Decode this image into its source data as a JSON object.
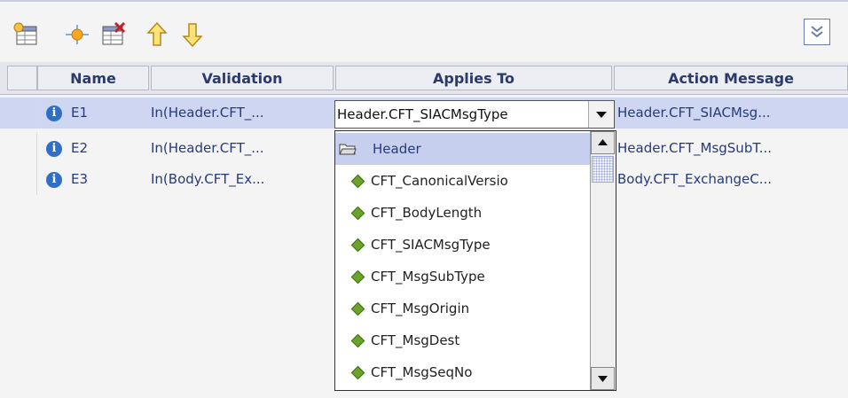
{
  "toolbar": {
    "icons": [
      "add-row-icon",
      "add-child-icon",
      "delete-row-icon",
      "move-up-icon",
      "move-down-icon",
      "collapse-icon"
    ]
  },
  "grid": {
    "columns": [
      "Name",
      "Validation",
      "Applies To",
      "Action Message"
    ],
    "rows": [
      {
        "name": "E1",
        "validation": "In(Header.CFT_...",
        "applies_to": "eader.CFT_SIACMsgType",
        "action_message": "Header.CFT_SIACMsg..."
      },
      {
        "name": "E2",
        "validation": "In(Header.CFT_...",
        "applies_to": "",
        "action_message": "Header.CFT_MsgSubT..."
      },
      {
        "name": "E3",
        "validation": "In(Body.CFT_Ex...",
        "applies_to": "",
        "action_message": "Body.CFT_ExchangeC..."
      }
    ]
  },
  "combo": {
    "value": "Header.CFT_SIACMsgType"
  },
  "dropdown": {
    "group": "Header",
    "items": [
      "CFT_CanonicalVersio",
      "CFT_BodyLength",
      "CFT_SIACMsgType",
      "CFT_MsgSubType",
      "CFT_MsgOrigin",
      "CFT_MsgDest",
      "CFT_MsgSeqNo"
    ]
  },
  "colors": {
    "header_text": "#2a3b6a",
    "selected_row": "#cfd6f1",
    "link_text": "#263b78",
    "dropdown_highlight": "#c7cfee",
    "leaf_diamond": "#6aa22e"
  }
}
